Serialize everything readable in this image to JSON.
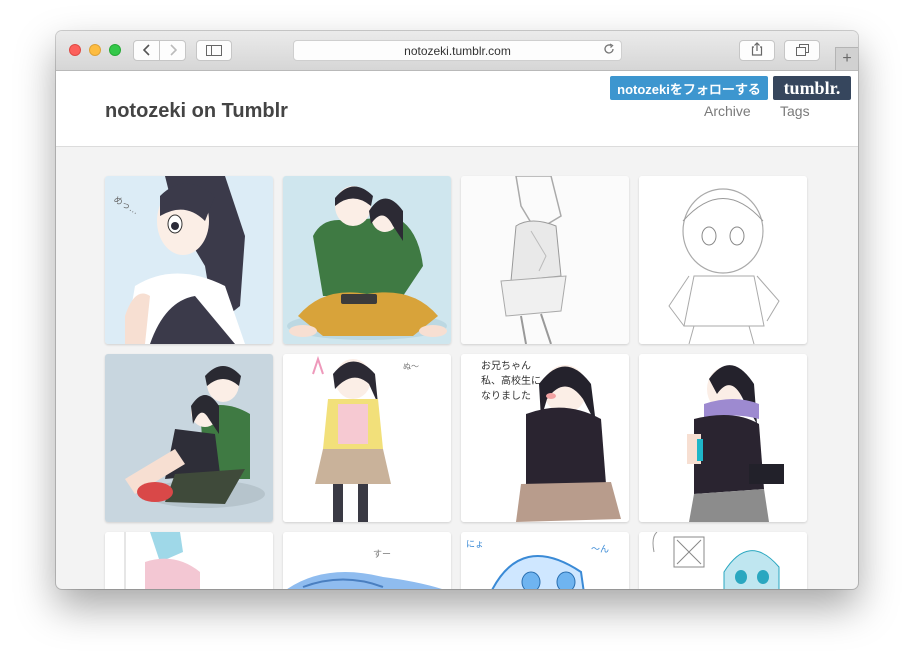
{
  "browser": {
    "url": "notozeki.tumblr.com"
  },
  "header": {
    "title": "notozeki on Tumblr",
    "follow_button": "notozekiをフォローする",
    "logo_text": "tumblr.",
    "nav": {
      "archive": "Archive",
      "tags": "Tags"
    }
  },
  "colors": {
    "follow_blue": "#3d96cf",
    "tumblr_navy": "#36465d",
    "page_bg": "#f3f3f3"
  },
  "grid": {
    "rows_visible": 3,
    "columns": 4
  }
}
